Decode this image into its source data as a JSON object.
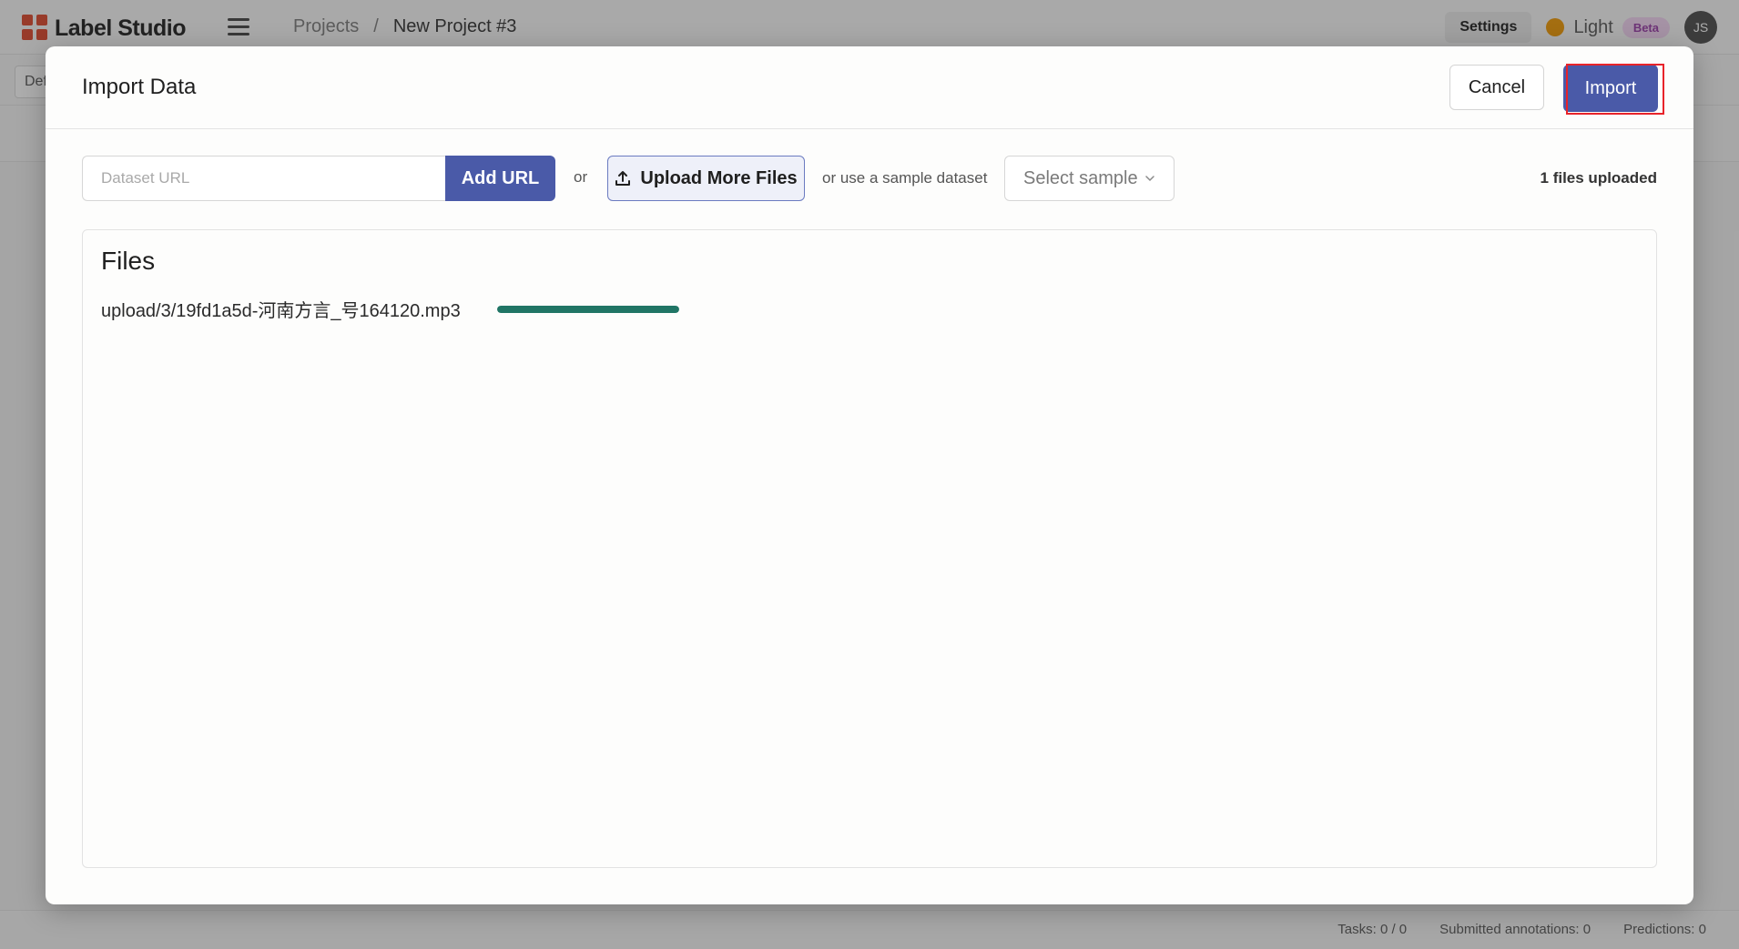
{
  "app": {
    "name": "Label Studio",
    "breadcrumbs": [
      "Projects",
      "/",
      "New Project #3"
    ],
    "settings_label": "Settings",
    "theme_label": "Light",
    "beta_label": "Beta",
    "avatar_initials": "JS",
    "tab_label": "Def",
    "footer": {
      "tasks": "Tasks: 0 / 0",
      "submitted": "Submitted annotations: 0",
      "predictions": "Predictions: 0"
    }
  },
  "modal": {
    "title": "Import Data",
    "cancel_label": "Cancel",
    "import_label": "Import",
    "url_placeholder": "Dataset URL",
    "add_url_label": "Add URL",
    "or_label": "or",
    "upload_label": "Upload More Files",
    "sample_text": "or use a sample dataset",
    "select_sample_label": "Select sample",
    "files_uploaded": "1 files uploaded",
    "files_heading": "Files",
    "files": [
      {
        "name": "upload/3/19fd1a5d-河南方言_号164120.mp3",
        "progress": 1.0
      }
    ]
  },
  "colors": {
    "primary": "#4a5aa8",
    "progress": "#207565",
    "highlight": "#e8232a",
    "logo": "#e0573f"
  }
}
